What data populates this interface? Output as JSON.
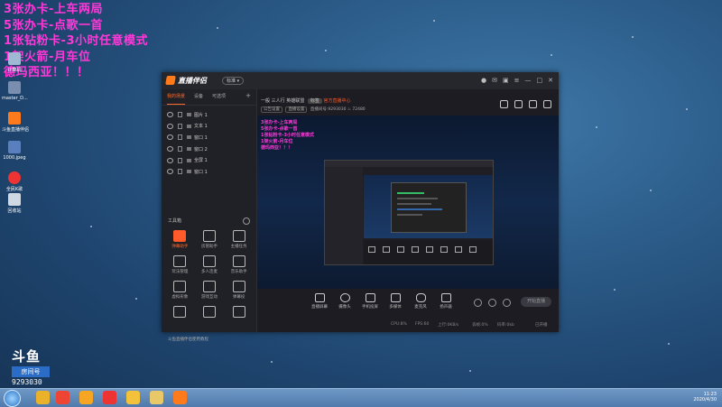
{
  "overlay": {
    "lines": [
      "3张办卡-上车两局",
      "5张办卡-点歌一首",
      "1张钻粉卡-3小时任意模式",
      "1架火箭-月车位",
      "德玛西亚！！！"
    ]
  },
  "desktop": {
    "icons": [
      {
        "label": "计算机",
        "color": "#9fb8d4"
      },
      {
        "label": "master_D...",
        "color": "#7a8fb0"
      },
      {
        "label": "斗鱼直播伴侣",
        "color": "#ff7a1a"
      },
      {
        "label": "1000.jpeg",
        "color": "#5a7fbf"
      },
      {
        "label": "全民K歌",
        "color": "#e33"
      },
      {
        "label": "回收站",
        "color": "#cfd8e3"
      }
    ]
  },
  "logo": {
    "brand": "斗鱼",
    "tag": "房间号",
    "room": "9293030"
  },
  "taskbar": {
    "apps": [
      {
        "name": "chrome-icon",
        "color": "#e9b22a"
      },
      {
        "name": "app-icon",
        "color": "#e43"
      },
      {
        "name": "app-icon-2",
        "color": "#f6a623"
      },
      {
        "name": "app-icon-3",
        "color": "#e33"
      },
      {
        "name": "app-icon-4",
        "color": "#f3c23a"
      },
      {
        "name": "folder-icon",
        "color": "#e9c86a"
      },
      {
        "name": "douyu-icon",
        "color": "#ff7a1a"
      }
    ],
    "time": "11:23",
    "date": "2020/4/30"
  },
  "app": {
    "title": "直播伴侣",
    "version": "标准 ▾",
    "tabs": [
      "我的场景",
      "设备",
      "可选项"
    ],
    "scenes": [
      "图片 1",
      "文本 1",
      "窗口 1",
      "窗口 2",
      "全屏 1",
      "窗口 1"
    ],
    "tools_header": "工具箱",
    "tools": [
      {
        "label": "弹幕助手",
        "active": true
      },
      {
        "label": "房管助手",
        "active": false
      },
      {
        "label": "主播任务",
        "active": false
      },
      {
        "label": "玩法管理",
        "active": false
      },
      {
        "label": "多人连麦",
        "active": false
      },
      {
        "label": "音乐助手",
        "active": false
      },
      {
        "label": "虚拟形象",
        "active": false
      },
      {
        "label": "游戏互动",
        "active": false
      },
      {
        "label": "弹幕投",
        "active": false
      },
      {
        "label": "",
        "active": false
      },
      {
        "label": "",
        "active": false
      },
      {
        "label": "",
        "active": false
      }
    ],
    "promo": "斗鱼直播伴侣使用教程",
    "room_info": {
      "level": "一般",
      "online": "三人行",
      "category": "英雄联盟",
      "tag": "标签",
      "notice": "官方直播中心"
    },
    "room_meta": {
      "btn1": "公告设置",
      "btn2": "直播设置",
      "room_line": "直播间号:9293030",
      "heat": "72480"
    },
    "preview_overlay": [
      "3张办卡-上车两局",
      "5张办卡-点歌一首",
      "1张钻粉卡-3小时任意模式",
      "1架火箭-月车位",
      "德玛西亚！！！"
    ],
    "controls": [
      "直播屏幕",
      "摄像头",
      "手机投屏",
      "多媒体",
      "麦克风",
      "扬声器"
    ],
    "start_live": "开始直播",
    "status": [
      "CPU:8%",
      "FPS:60",
      "上行:0KB/s",
      "丢帧:0%",
      "码率:0kb",
      "已开播"
    ]
  }
}
